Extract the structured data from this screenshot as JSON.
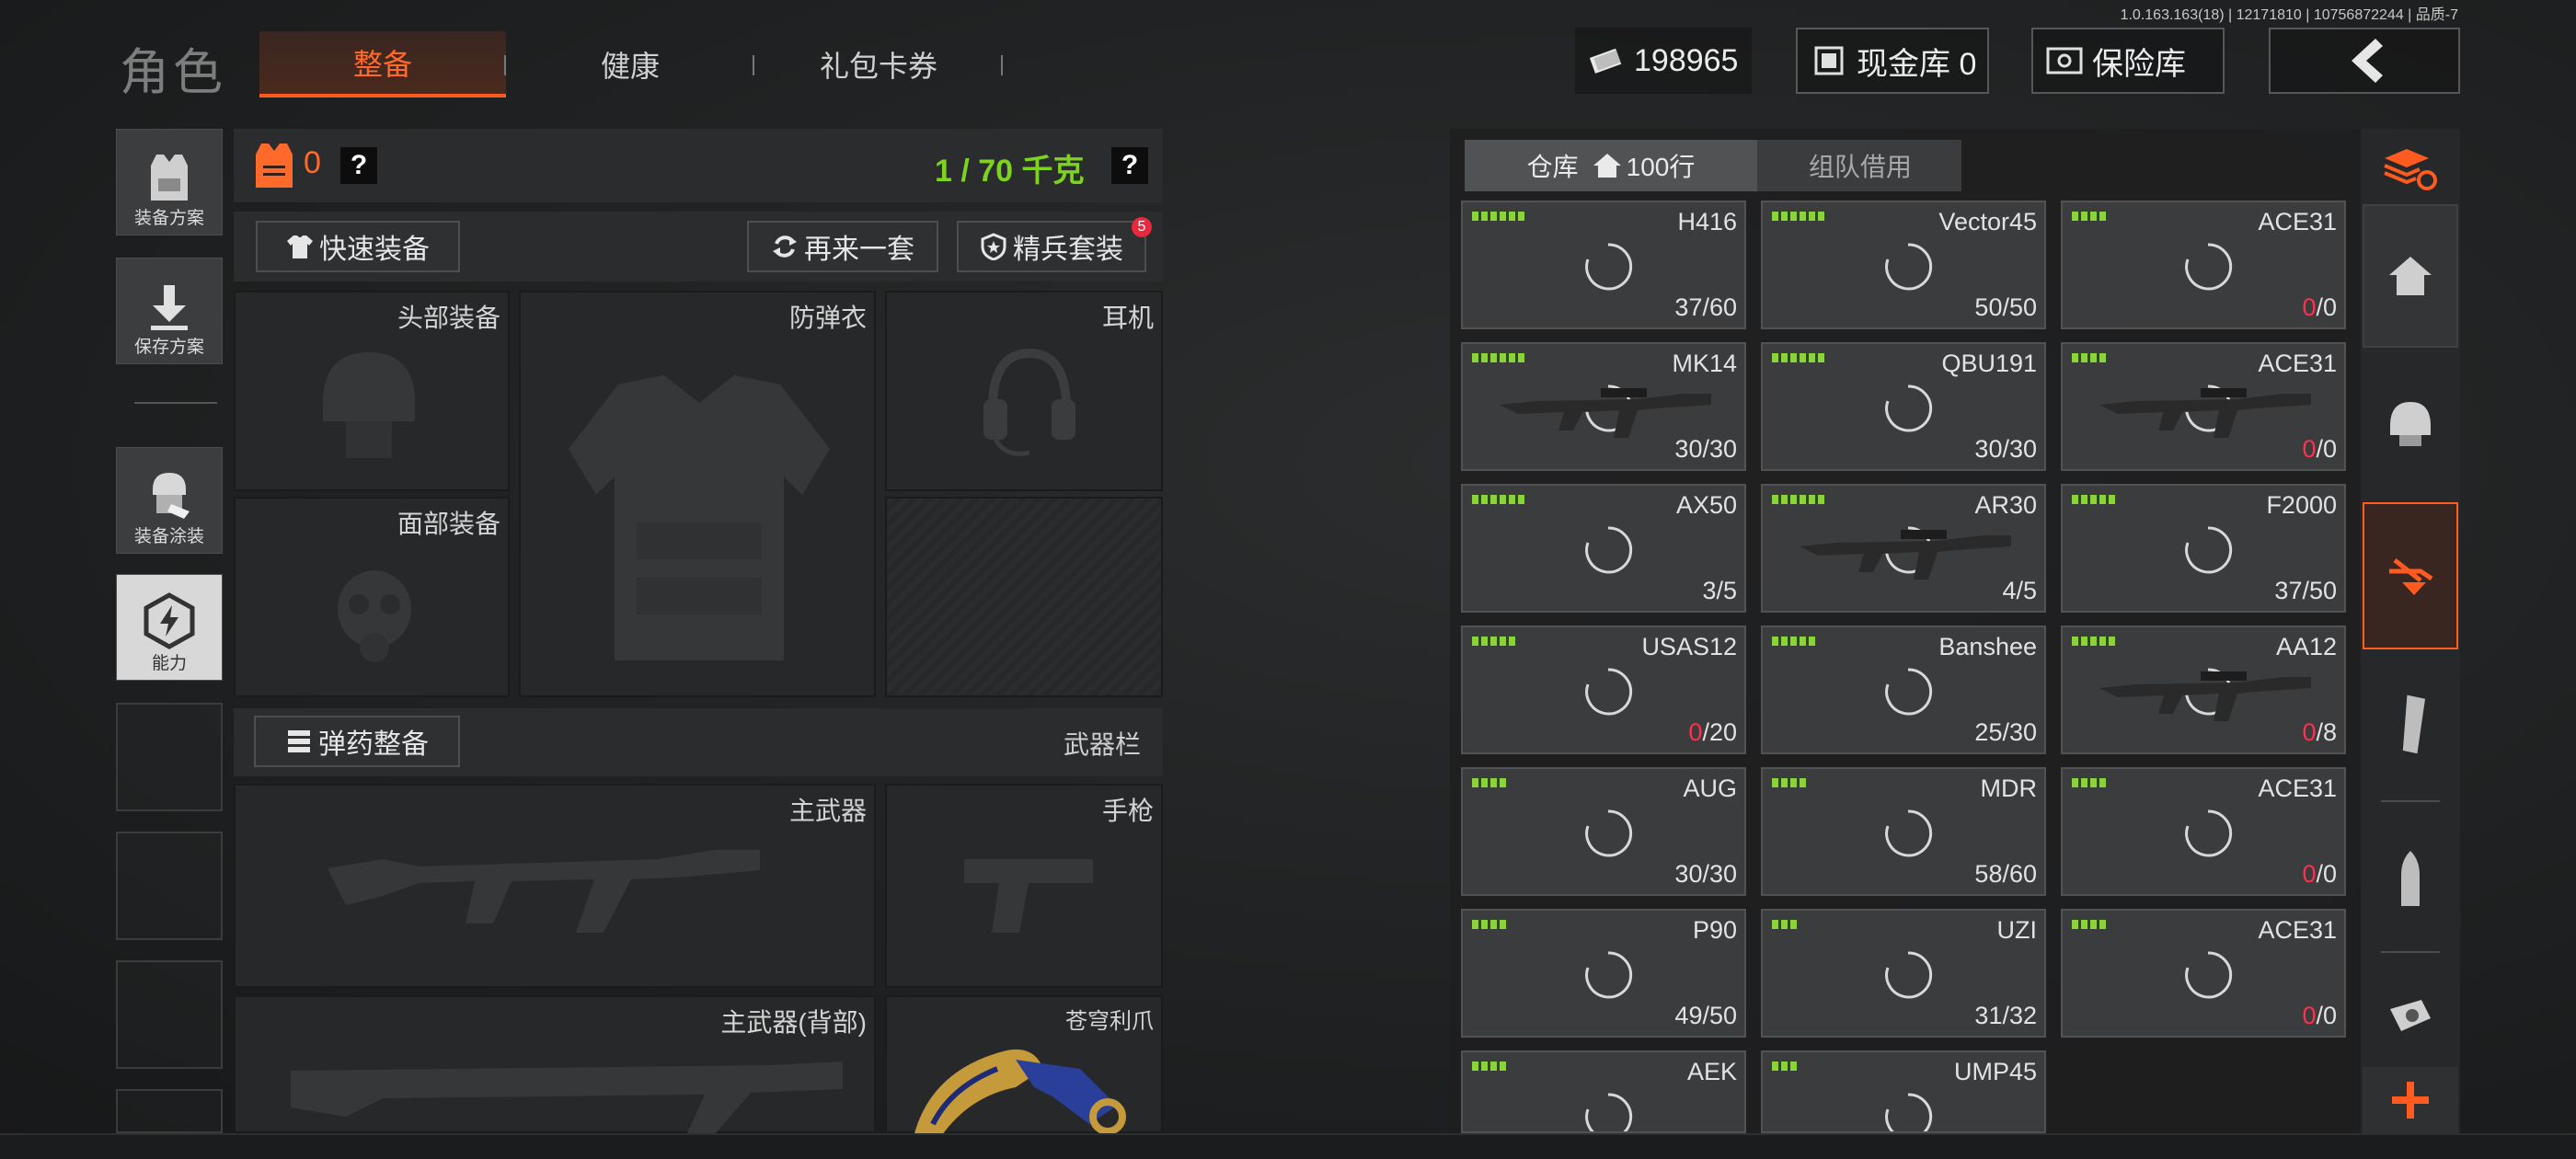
{
  "version": "1.0.163.163(18) | 12171810 | 10756872244 | 品质-7",
  "header": {
    "title": "角色",
    "tabs": [
      "整备",
      "健康",
      "礼包卡券"
    ],
    "money": "198965",
    "cash_vault": "现金库 0",
    "safe_vault": "保险库"
  },
  "sidebar": {
    "items": [
      {
        "label": "装备方案",
        "icon": "vest-icon"
      },
      {
        "label": "保存方案",
        "icon": "download-icon"
      },
      {
        "label": "装备涂装",
        "icon": "skin-icon"
      },
      {
        "label": "能力",
        "icon": "ability-icon"
      }
    ]
  },
  "loadout": {
    "armor_count": "0",
    "help": "?",
    "weight": "1 / 70 千克",
    "quick_equip": "快速装备",
    "again": "再来一套",
    "elite": "精兵套装",
    "elite_badge": "5",
    "slots": {
      "head": "头部装备",
      "vest": "防弹衣",
      "headset": "耳机",
      "face": "面部装备",
      "ammo": "弹药整备",
      "weapon_bar": "武器栏",
      "primary": "主武器",
      "pistol": "手枪",
      "primary_back": "主武器(背部)",
      "melee": "苍穹利爪"
    }
  },
  "warehouse": {
    "tab_storage": "仓库",
    "tab_storage_rows": "100行",
    "tab_team": "组队借用",
    "items": [
      {
        "name": "H416",
        "count": "37/60",
        "red": "",
        "bars": 6,
        "gun": false
      },
      {
        "name": "Vector45",
        "count": "50/50",
        "red": "",
        "bars": 6,
        "gun": false
      },
      {
        "name": "ACE31",
        "count": "/0",
        "red": "0",
        "bars": 4,
        "gun": false
      },
      {
        "name": "MK14",
        "count": "30/30",
        "red": "",
        "bars": 6,
        "gun": true
      },
      {
        "name": "QBU191",
        "count": "30/30",
        "red": "",
        "bars": 6,
        "gun": false
      },
      {
        "name": "ACE31",
        "count": "/0",
        "red": "0",
        "bars": 4,
        "gun": true
      },
      {
        "name": "AX50",
        "count": "3/5",
        "red": "",
        "bars": 6,
        "gun": false
      },
      {
        "name": "AR30",
        "count": "4/5",
        "red": "",
        "bars": 6,
        "gun": true
      },
      {
        "name": "F2000",
        "count": "37/50",
        "red": "",
        "bars": 5,
        "gun": false
      },
      {
        "name": "USAS12",
        "count": "/20",
        "red": "0",
        "bars": 5,
        "gun": false
      },
      {
        "name": "Banshee",
        "count": "25/30",
        "red": "",
        "bars": 5,
        "gun": false
      },
      {
        "name": "AA12",
        "count": "/8",
        "red": "0",
        "bars": 5,
        "gun": true
      },
      {
        "name": "AUG",
        "count": "30/30",
        "red": "",
        "bars": 4,
        "gun": false
      },
      {
        "name": "MDR",
        "count": "58/60",
        "red": "",
        "bars": 4,
        "gun": false
      },
      {
        "name": "ACE31",
        "count": "/0",
        "red": "0",
        "bars": 4,
        "gun": false
      },
      {
        "name": "P90",
        "count": "49/50",
        "red": "",
        "bars": 4,
        "gun": false
      },
      {
        "name": "UZI",
        "count": "31/32",
        "red": "",
        "bars": 3,
        "gun": false
      },
      {
        "name": "ACE31",
        "count": "/0",
        "red": "0",
        "bars": 4,
        "gun": false
      },
      {
        "name": "AEK",
        "count": "",
        "red": "",
        "bars": 4,
        "gun": false
      },
      {
        "name": "UMP45",
        "count": "",
        "red": "",
        "bars": 3,
        "gun": false
      }
    ]
  },
  "colors": {
    "accent": "#ff5a1f",
    "green": "#7ed321",
    "red": "#ff2f4e"
  }
}
